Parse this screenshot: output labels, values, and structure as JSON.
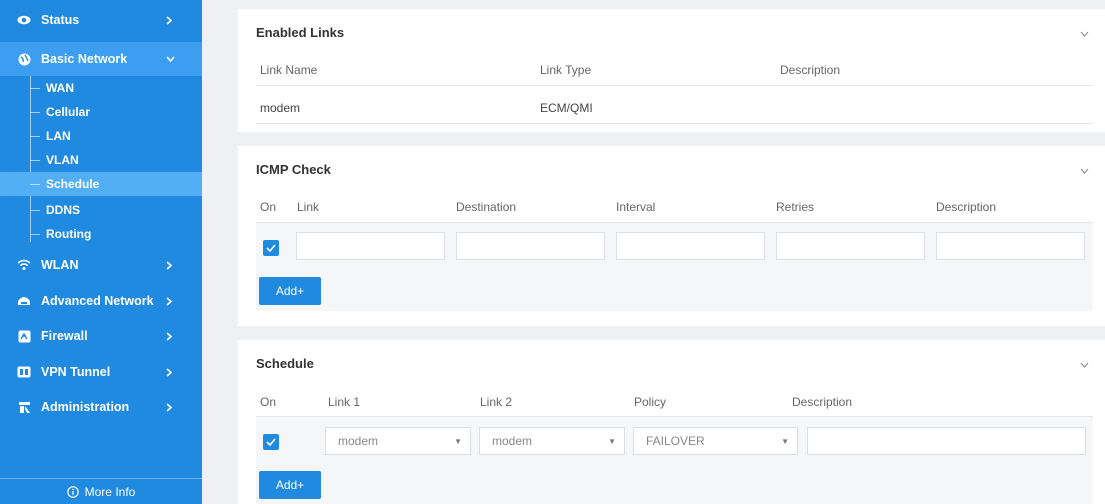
{
  "sidebar": {
    "items": [
      {
        "label": "Status",
        "icon": "eye-icon"
      },
      {
        "label": "Basic Network",
        "icon": "globe-icon"
      },
      {
        "label": "WLAN",
        "icon": "wifi-icon"
      },
      {
        "label": "Advanced Network",
        "icon": "network-icon"
      },
      {
        "label": "Firewall",
        "icon": "shield-icon"
      },
      {
        "label": "VPN Tunnel",
        "icon": "vpn-icon"
      },
      {
        "label": "Administration",
        "icon": "admin-icon"
      }
    ],
    "sub_items": [
      "WAN",
      "Cellular",
      "LAN",
      "VLAN",
      "Schedule",
      "DDNS",
      "Routing"
    ],
    "active_sub_item": "Schedule",
    "more_info": "More Info"
  },
  "enabled_links": {
    "title": "Enabled Links",
    "columns": [
      "Link Name",
      "Link Type",
      "Description"
    ],
    "rows": [
      {
        "name": "modem",
        "type": "ECM/QMI",
        "description": ""
      }
    ]
  },
  "icmp_check": {
    "title": "ICMP Check",
    "columns": [
      "On",
      "Link",
      "Destination",
      "Interval",
      "Retries",
      "Description"
    ],
    "add_label": "Add+"
  },
  "schedule": {
    "title": "Schedule",
    "columns": [
      "On",
      "Link 1",
      "Link 2",
      "Policy",
      "Description"
    ],
    "row": {
      "link1": "modem",
      "link2": "modem",
      "policy": "FAILOVER"
    },
    "add_label": "Add+"
  },
  "colors": {
    "accent": "#1f8ae0",
    "sidebar_active": "#52aef5"
  }
}
